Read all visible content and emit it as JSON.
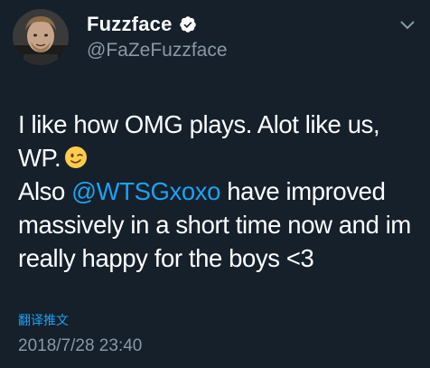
{
  "user": {
    "display_name": "Fuzzface",
    "handle": "@FaZeFuzzface",
    "verified": true
  },
  "tweet": {
    "line1": "I like how OMG plays. Alot like us,",
    "line2": "WP.",
    "emoji": "winking-face-emoji",
    "also": "Also ",
    "mention": "@WTSGxoxo",
    "rest": " have improved massively in a short time now and im really happy for the boys <3",
    "translate_label": "翻译推文",
    "timestamp": "2018/7/28 23:40"
  },
  "colors": {
    "background": "#15202b",
    "text": "#ffffff",
    "muted": "#8899a6",
    "accent": "#1da1f2"
  }
}
